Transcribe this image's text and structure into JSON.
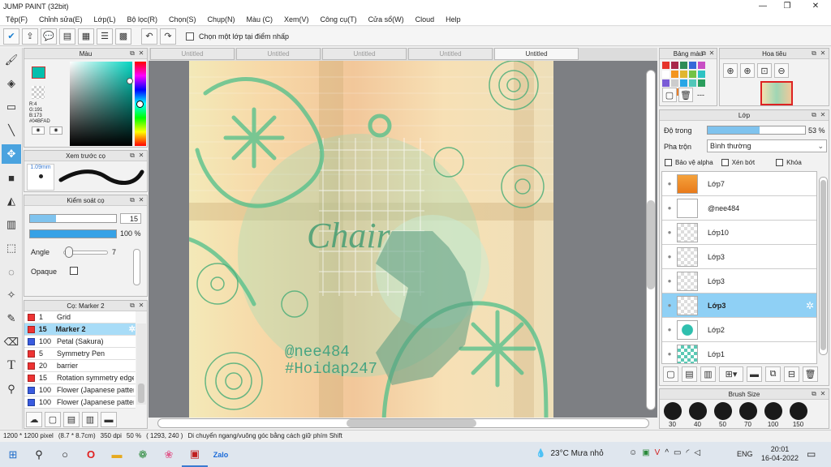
{
  "window": {
    "title": "JUMP PAINT (32bit)",
    "min": "—",
    "max": "❐",
    "close": "✕"
  },
  "menu": [
    "Tệp(F)",
    "Chỉnh sửa(E)",
    "Lớp(L)",
    "Bộ lọc(R)",
    "Chọn(S)",
    "Chụp(N)",
    "Màu (C)",
    "Xem(V)",
    "Công cụ(T)",
    "Cửa sổ(W)",
    "Cloud",
    "Help"
  ],
  "toolbar": {
    "checkbox_label": "Chọn một lớp tại điểm nhấp"
  },
  "color_panel": {
    "title": "Màu",
    "r": "R:4",
    "g": "G:191",
    "b": "B:173",
    "hex": "#04BFAD",
    "fg": "#04BFAD",
    "bg": "#ffffff"
  },
  "preview_panel": {
    "title": "Xem trước cọ",
    "size": "1.09mm"
  },
  "brush_control": {
    "title": "Kiểm soát cọ",
    "size_value": "15",
    "opacity_value": "100",
    "opacity_unit": "%",
    "size_level": 0.3,
    "opacity_level": 1.0,
    "angle_label": "Angle",
    "angle_value": "7",
    "opaque_label": "Opaque"
  },
  "brush_list": {
    "title": "Cọ: Marker 2",
    "items": [
      {
        "num": "1",
        "name": "Grid",
        "color": "red"
      },
      {
        "num": "15",
        "name": "Marker 2",
        "color": "red",
        "selected": true
      },
      {
        "num": "100",
        "name": "Petal (Sakura)",
        "color": "blue"
      },
      {
        "num": "5",
        "name": "Symmetry Pen",
        "color": "red"
      },
      {
        "num": "20",
        "name": "barrier",
        "color": "red"
      },
      {
        "num": "15",
        "name": "Rotation symmetry edge",
        "color": "red"
      },
      {
        "num": "100",
        "name": "Flower (Japanese pattern)",
        "color": "blue"
      },
      {
        "num": "100",
        "name": "Flower (Japanese pattern)",
        "color": "blue"
      }
    ]
  },
  "doc_tabs": [
    "Untitled",
    "Untitled",
    "Untitled",
    "Untitled",
    "Untitled"
  ],
  "artwork": {
    "watermark1": "@nee484",
    "watermark2": "#Hoidap247",
    "title_text": "Chair"
  },
  "palette_panel": {
    "title": "Bảng màu",
    "colors": [
      "#e6342b",
      "#a8284b",
      "#2e8b57",
      "#3569d8",
      "#c84ec4",
      "#ffffff",
      "#f3951f",
      "#e0b630",
      "#73c244",
      "#2ec3c3",
      "#7a5cd6",
      "#cccccc",
      "#29a6e6",
      "#52c7b9",
      "#2a9d5c",
      "#f0d93a",
      "#e97f2a",
      "#999999"
    ]
  },
  "navigator_panel": {
    "title": "Hoa tiêu"
  },
  "layer_panel": {
    "title": "Lớp",
    "opacity_label": "Độ trong",
    "opacity_value": "53",
    "opacity_unit": "%",
    "opacity_level": 0.53,
    "blend_label": "Pha trộn",
    "blend_value": "Bình thường",
    "protect_alpha": "Bảo vệ alpha",
    "clip": "Xén bớt",
    "lock": "Khóa",
    "layers": [
      {
        "name": "Lớp7",
        "selected": false
      },
      {
        "name": "@nee484",
        "selected": false
      },
      {
        "name": "Lớp10",
        "selected": false
      },
      {
        "name": "Lớp3",
        "selected": false
      },
      {
        "name": "Lớp3",
        "selected": false
      },
      {
        "name": "Lớp3",
        "selected": true
      },
      {
        "name": "Lớp2",
        "selected": false
      },
      {
        "name": "Lớp1",
        "selected": false
      }
    ]
  },
  "brush_size_panel": {
    "title": "Brush Size",
    "sizes": [
      "30",
      "40",
      "50",
      "70",
      "100",
      "150"
    ]
  },
  "status": {
    "dimensions": "1200 * 1200 pixel",
    "size": "(8.7 * 8.7cm)",
    "dpi": "350 dpi",
    "zoom": "50 %",
    "coords": "( 1293, 240 )",
    "hint": "Di chuyển ngang/vuông góc bằng cách giữ phím Shift"
  },
  "taskbar": {
    "weather": "23°C  Mưa nhỏ",
    "lang": "ENG",
    "time": "20:01",
    "date": "16-04-2022"
  }
}
